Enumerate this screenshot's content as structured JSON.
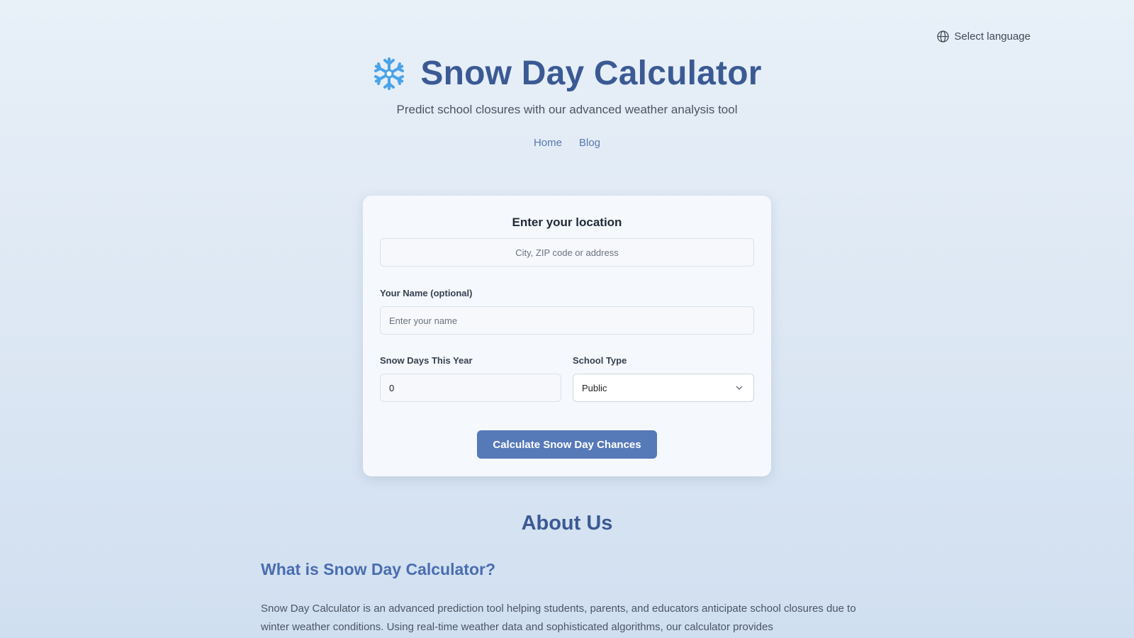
{
  "language": {
    "label": "Select language",
    "icon": "globe-icon"
  },
  "header": {
    "icon": "snowflake-icon",
    "title": "Snow Day Calculator",
    "subtitle": "Predict school closures with our advanced weather analysis tool"
  },
  "nav": {
    "home": "Home",
    "blog": "Blog"
  },
  "form": {
    "location_heading": "Enter your location",
    "location_placeholder": "City, ZIP code or address",
    "name_label": "Your Name (optional)",
    "name_placeholder": "Enter your name",
    "snow_days_label": "Snow Days This Year",
    "snow_days_value": "0",
    "school_type_label": "School Type",
    "school_type_value": "Public",
    "submit_label": "Calculate Snow Day Chances"
  },
  "about": {
    "title": "About Us",
    "subtitle": "What is Snow Day Calculator?",
    "text": "Snow Day Calculator is an advanced prediction tool helping students, parents, and educators anticipate school closures due to winter weather conditions. Using real-time weather data and sophisticated algorithms, our calculator provides"
  },
  "colors": {
    "accent": "#3b5a94",
    "button": "#5679b8",
    "link": "#5878ad"
  }
}
